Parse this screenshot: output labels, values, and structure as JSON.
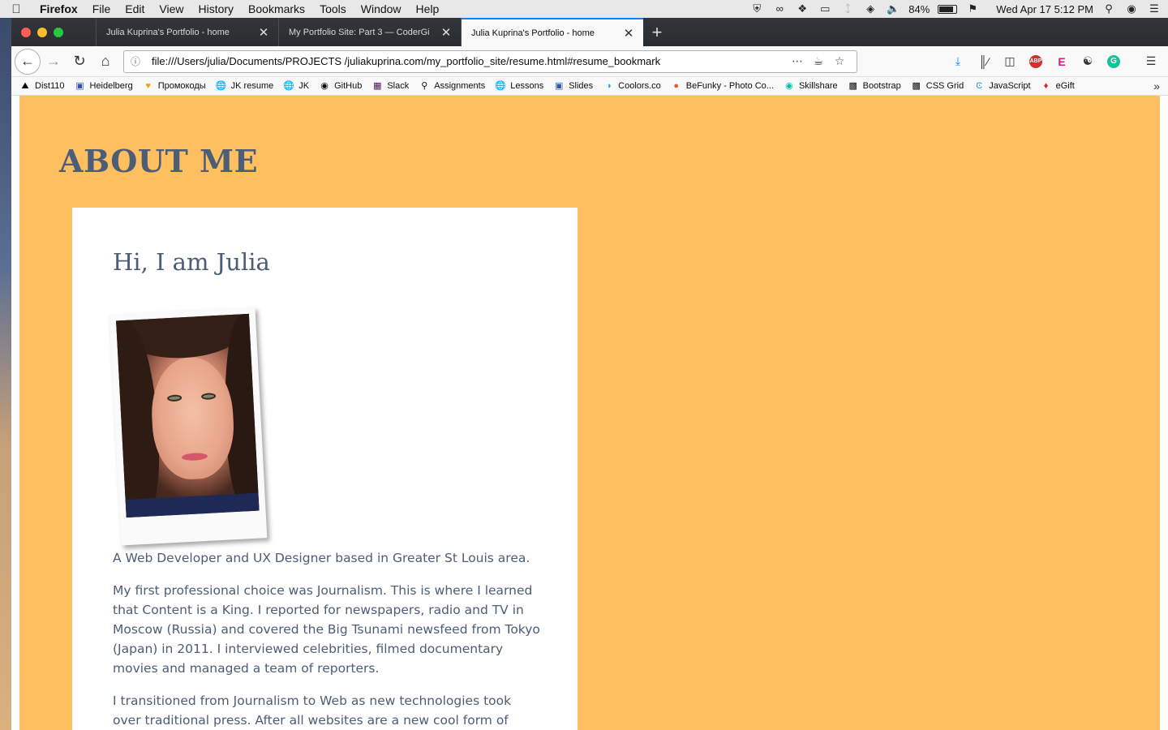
{
  "menubar": {
    "app_name": "Firefox",
    "items": [
      "File",
      "Edit",
      "View",
      "History",
      "Bookmarks",
      "Tools",
      "Window",
      "Help"
    ],
    "battery": "84%",
    "clock": "Wed Apr 17  5:12 PM",
    "battery_level": 0.84
  },
  "tabs": [
    {
      "title": "Julia Kuprina's Portfolio - home",
      "active": false
    },
    {
      "title": "My Portfolio Site: Part 3 — CoderGi",
      "active": false
    },
    {
      "title": "Julia Kuprina's Portfolio - home",
      "active": true
    }
  ],
  "navbar": {
    "url": "file:///Users/julia/Documents/PROJECTS /juliakuprina.com/my_portfolio_site/resume.html#resume_bookmark"
  },
  "bookmarks": [
    {
      "label": "Dist110",
      "icon": "mountain-icon"
    },
    {
      "label": "Heidelberg",
      "icon": "page-icon"
    },
    {
      "label": "Промокоды",
      "icon": "heart-icon"
    },
    {
      "label": "JK resume",
      "icon": "globe-icon"
    },
    {
      "label": "JK",
      "icon": "globe-icon"
    },
    {
      "label": "GitHub",
      "icon": "github-icon"
    },
    {
      "label": "Slack",
      "icon": "slack-icon"
    },
    {
      "label": "Assignments",
      "icon": "pin-icon"
    },
    {
      "label": "Lessons",
      "icon": "globe-icon"
    },
    {
      "label": "Slides",
      "icon": "page-icon"
    },
    {
      "label": "Coolors.co",
      "icon": "coolors-icon"
    },
    {
      "label": "BeFunky - Photo Co...",
      "icon": "befunky-icon"
    },
    {
      "label": "Skillshare",
      "icon": "skillshare-icon"
    },
    {
      "label": "Bootstrap",
      "icon": "grid-icon"
    },
    {
      "label": "CSS Grid",
      "icon": "grid-icon"
    },
    {
      "label": "JavaScript",
      "icon": "udemy-icon"
    },
    {
      "label": "eGift",
      "icon": "gift-icon"
    }
  ],
  "page": {
    "section_heading": "ABOUT ME",
    "card_title": "Hi, I am Julia",
    "photo_alt": "portrait-photo",
    "paragraph1": "A Web Developer and UX Designer based in Greater St Louis area.",
    "paragraph2": "My first professional choice was Journalism. This is where I learned that Content is a King. I reported for newspapers, radio and TV in Moscow (Russia) and covered the Big Tsunami newsfeed from Tokyo (Japan) in 2011. I interviewed celebrities, filmed documentary movies and managed a team of reporters.",
    "paragraph3": "I transitioned from Journalism to Web as new technologies took over traditional press. After all websites are a new cool form of mass media.",
    "background_color": "#fdbf60",
    "text_color": "#4c5d75"
  }
}
